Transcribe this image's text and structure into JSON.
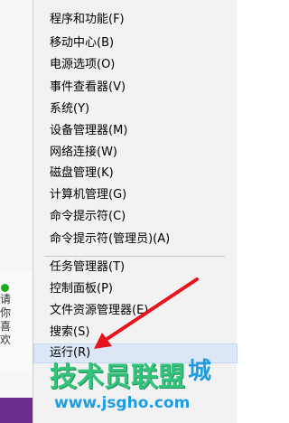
{
  "menu": {
    "group1": [
      {
        "label": "程序和功能(F)"
      },
      {
        "label": "移动中心(B)"
      },
      {
        "label": "电源选项(O)"
      },
      {
        "label": "事件查看器(V)"
      },
      {
        "label": "系统(Y)"
      },
      {
        "label": "设备管理器(M)"
      },
      {
        "label": "网络连接(W)"
      },
      {
        "label": "磁盘管理(K)"
      },
      {
        "label": "计算机管理(G)"
      },
      {
        "label": "命令提示符(C)"
      },
      {
        "label": "命令提示符(管理员)(A)"
      }
    ],
    "group2": [
      {
        "label": "任务管理器(T)"
      },
      {
        "label": "控制面板(P)"
      },
      {
        "label": "文件资源管理器(E)"
      },
      {
        "label": "搜索(S)"
      },
      {
        "label": "运行(R)",
        "highlighted": true
      }
    ]
  },
  "background": {
    "chat_text": "请你喜欢"
  },
  "watermark": {
    "logo_text": "技术员联盟",
    "url": "www.jsgho.com",
    "right_text": "城"
  },
  "colors": {
    "menu_bg": "#f2f2f2",
    "highlight": "#dbe7f7",
    "arrow": "#e8141c",
    "watermark_green": "#1fbf6e",
    "watermark_blue": "#1f9de0"
  }
}
